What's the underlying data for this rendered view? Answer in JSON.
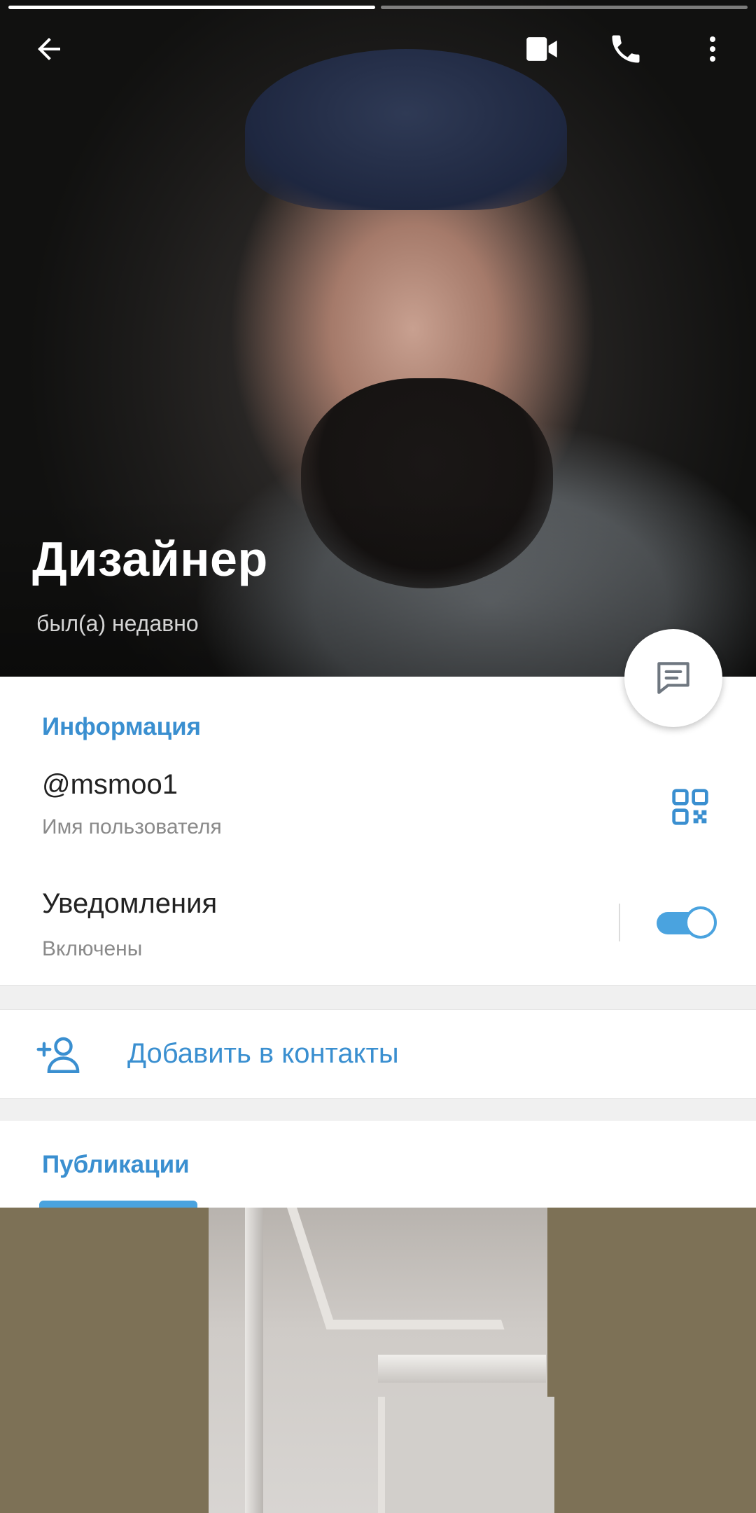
{
  "profile": {
    "name": "Дизайнер",
    "status": "был(а) недавно"
  },
  "topbar": {
    "back_icon": "arrow-back-icon",
    "video_icon": "video-camera-icon",
    "call_icon": "phone-icon",
    "more_icon": "more-vertical-icon"
  },
  "info": {
    "section_title": "Информация",
    "username": "@msmoo1",
    "username_label": "Имя пользователя",
    "notifications_title": "Уведомления",
    "notifications_state": "Включены",
    "notifications_enabled": true
  },
  "actions": {
    "add_contact": "Добавить в контакты"
  },
  "tabs": {
    "publications": "Публикации"
  },
  "colors": {
    "accent": "#3a8fd0",
    "toggle": "#4aa3df"
  }
}
